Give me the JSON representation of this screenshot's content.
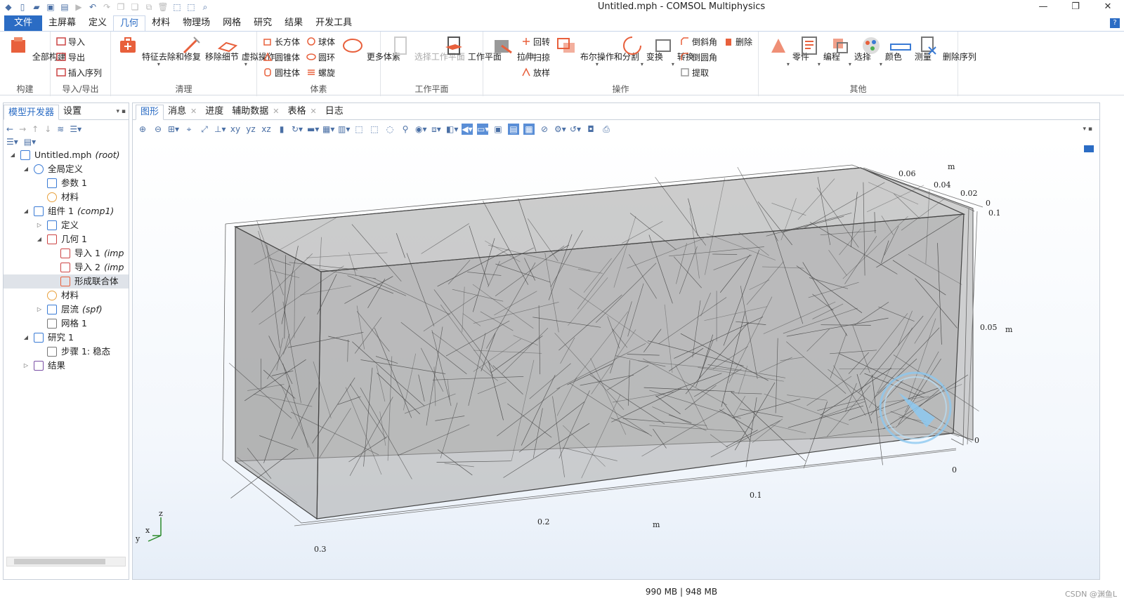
{
  "window": {
    "title": "Untitled.mph - COMSOL Multiphysics"
  },
  "ribbon": {
    "tabs": [
      "文件",
      "主屏幕",
      "定义",
      "几何",
      "材料",
      "物理场",
      "网格",
      "研究",
      "结果",
      "开发工具"
    ],
    "active_tab": "几何",
    "groups": {
      "build": {
        "label": "构建",
        "build_all": "全部构建"
      },
      "import_export": {
        "label": "导入/导出",
        "import": "导入",
        "export": "导出",
        "insert_sequence": "插入序列"
      },
      "cleanup": {
        "label": "清理",
        "defeature": "特征去除和修复",
        "remove_details": "移除细节",
        "virtual_ops": "虚拟操作"
      },
      "primitives": {
        "label": "体素",
        "block": "长方体",
        "sphere": "球体",
        "cone": "圆锥体",
        "torus": "圆环",
        "cylinder": "圆柱体",
        "helix": "螺旋",
        "more": "更多体素"
      },
      "workplane": {
        "label": "工作平面",
        "select_wp": "选择工作平面",
        "wp": "工作平面"
      },
      "operations": {
        "label": "操作",
        "extrude": "拉伸",
        "revolve": "回转",
        "sweep": "扫掠",
        "loft": "放样",
        "boolean": "布尔操作和分割",
        "transforms": "变换",
        "conversions": "转换",
        "chamfer": "倒斜角",
        "fillet": "倒圆角",
        "extract": "提取",
        "delete": "删除"
      },
      "other": {
        "label": "其他",
        "parts": "零件",
        "programming": "编程",
        "selections": "选择",
        "colors": "颜色",
        "measure": "测量",
        "delete_sequence": "删除序列"
      }
    }
  },
  "left_panel": {
    "tabs": [
      "模型开发器",
      "设置"
    ],
    "tree": [
      {
        "label": "Untitled.mph",
        "suffix": "(root)",
        "level": 0,
        "expanded": true,
        "icon": "model-icon"
      },
      {
        "label": "全局定义",
        "suffix": "",
        "level": 1,
        "expanded": true,
        "icon": "globe-icon"
      },
      {
        "label": "参数 1",
        "suffix": "",
        "level": 2,
        "icon": "parameter-icon"
      },
      {
        "label": "材料",
        "suffix": "",
        "level": 2,
        "icon": "material-icon"
      },
      {
        "label": "组件 1",
        "suffix": "(comp1)",
        "level": 1,
        "expanded": true,
        "icon": "component-icon"
      },
      {
        "label": "定义",
        "suffix": "",
        "level": 2,
        "expanded": false,
        "icon": "definitions-icon"
      },
      {
        "label": "几何 1",
        "suffix": "",
        "level": 2,
        "expanded": true,
        "icon": "geometry-icon"
      },
      {
        "label": "导入 1",
        "suffix": "(imp",
        "level": 3,
        "icon": "import-icon"
      },
      {
        "label": "导入 2",
        "suffix": "(imp",
        "level": 3,
        "icon": "import-icon"
      },
      {
        "label": "形成联合体",
        "suffix": "",
        "level": 3,
        "icon": "form-union-icon",
        "selected": true
      },
      {
        "label": "材料",
        "suffix": "",
        "level": 2,
        "icon": "material-icon"
      },
      {
        "label": "层流",
        "suffix": "(spf)",
        "level": 2,
        "expanded": false,
        "icon": "laminar-flow-icon"
      },
      {
        "label": "网格 1",
        "suffix": "",
        "level": 2,
        "icon": "mesh-icon"
      },
      {
        "label": "研究 1",
        "suffix": "",
        "level": 1,
        "expanded": true,
        "icon": "study-icon"
      },
      {
        "label": "步骤 1: 稳态",
        "suffix": "",
        "level": 2,
        "icon": "step-icon"
      },
      {
        "label": "结果",
        "suffix": "",
        "level": 1,
        "expanded": false,
        "icon": "results-icon"
      }
    ]
  },
  "graphics_panel": {
    "tabs": [
      {
        "label": "图形",
        "closable": false
      },
      {
        "label": "消息",
        "closable": true
      },
      {
        "label": "进度",
        "closable": false
      },
      {
        "label": "辅助数据",
        "closable": true
      },
      {
        "label": "表格",
        "closable": true
      },
      {
        "label": "日志",
        "closable": false
      }
    ],
    "axis_labels": {
      "x_ticks": [
        "0.3",
        "0.2",
        "0.1",
        "0"
      ],
      "x_unit": "m",
      "y_ticks": [
        "0.06",
        "0.04",
        "0.02",
        "0"
      ],
      "y_unit": "m",
      "z_ticks": [
        "0.1",
        "0.05",
        "0"
      ],
      "z_unit": "m",
      "triad": [
        "z",
        "y",
        "x"
      ]
    }
  },
  "status_bar": {
    "memory": "990 MB | 948 MB",
    "watermark": "CSDN @渊鱼L"
  },
  "colors": {
    "accent": "#2b6cc4",
    "box_fill": "#a9a9a9",
    "fiber": "#444444"
  }
}
